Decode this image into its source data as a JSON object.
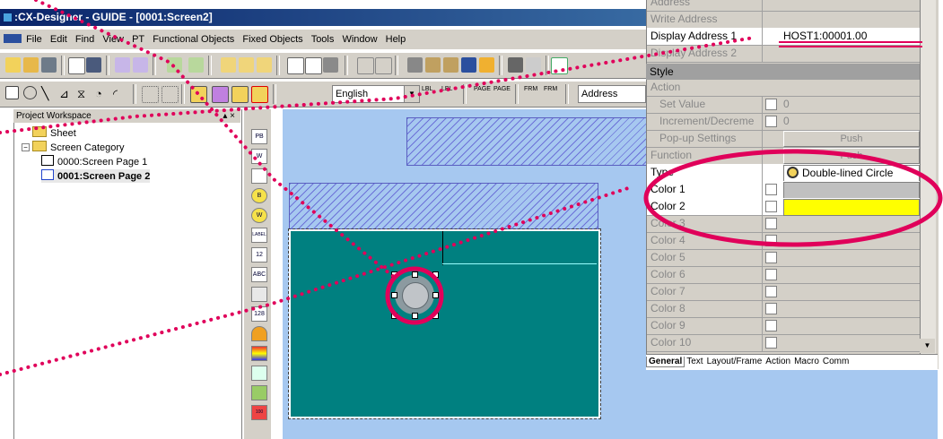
{
  "window": {
    "title": ":CX-Designer - GUIDE - [0001:Screen2]"
  },
  "menu": [
    "File",
    "Edit",
    "Find",
    "View",
    "PT",
    "Functional Objects",
    "Fixed Objects",
    "Tools",
    "Window",
    "Help"
  ],
  "toolbar": {
    "language": "English",
    "address_field": "Address"
  },
  "workspace": {
    "title": "Project Workspace",
    "close": "▴ ×",
    "items": [
      "Sheet",
      "Screen Category",
      "0000:Screen Page 1",
      "0001:Screen Page 2"
    ]
  },
  "vtools": [
    "PB",
    "W",
    "",
    "B",
    "W",
    "LABEL",
    "12",
    "ABC",
    "",
    "128",
    "",
    "",
    "",
    "",
    "100"
  ],
  "properties": {
    "top_rows": [
      {
        "label": "Address",
        "value": "",
        "enabled": false
      },
      {
        "label": "Write Address",
        "value": "",
        "enabled": false
      },
      {
        "label": "Display Address 1",
        "value": "HOST1:00001.00",
        "enabled": true
      },
      {
        "label": "Display Address 2",
        "value": "",
        "enabled": false
      }
    ],
    "style_header": "Style",
    "action_rows": [
      {
        "label": "Action",
        "value": ""
      },
      {
        "label": "Set Value",
        "value": "0"
      },
      {
        "label": "Increment/Decreme",
        "value": "0"
      },
      {
        "label": "Pop-up Settings",
        "button": "Push"
      },
      {
        "label": "Function",
        "button": "Push"
      }
    ],
    "type_label": "Type",
    "type_value": "Double-lined Circle",
    "colors": [
      "Color 1",
      "Color 2",
      "Color 3",
      "Color 4",
      "Color 5",
      "Color 6",
      "Color 7",
      "Color 8",
      "Color 9",
      "Color 10"
    ],
    "color_values": {
      "color1": "#c0c0c0",
      "color2": "#ffff00"
    },
    "tabs": [
      "General",
      "Text",
      "Layout/Frame",
      "Action",
      "Macro",
      "Comm"
    ]
  }
}
